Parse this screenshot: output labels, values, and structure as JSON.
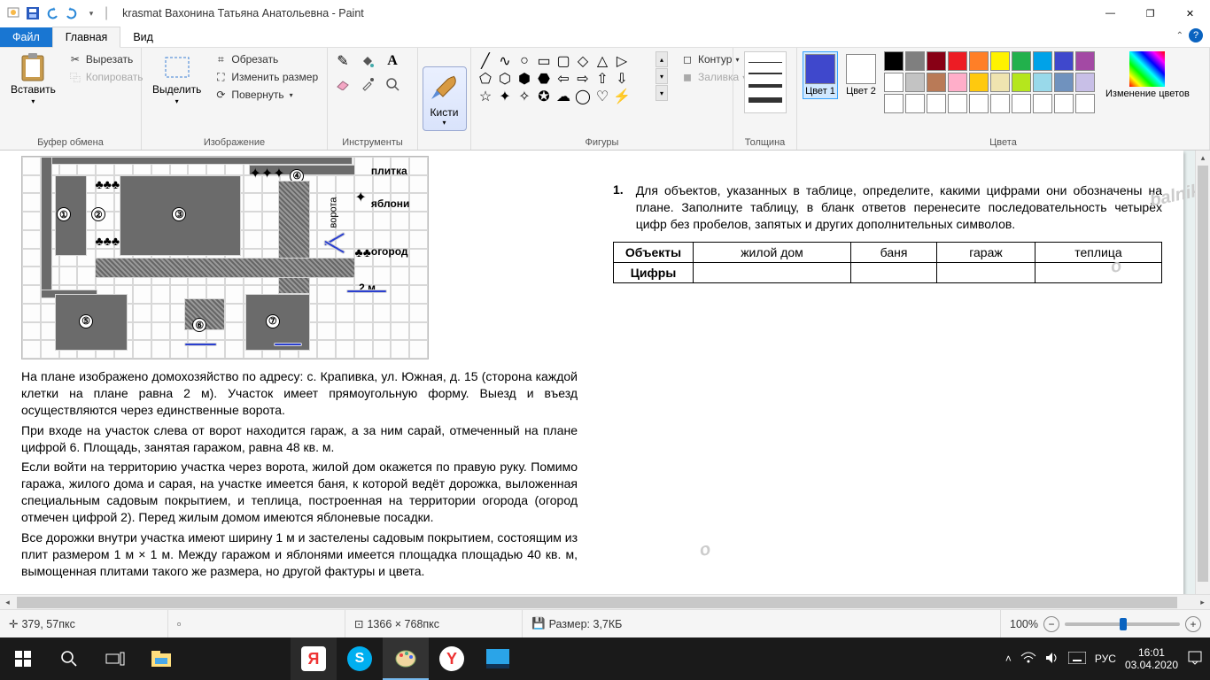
{
  "title": "krasmat Вахонина Татьяна Анатольевна - Paint",
  "tabs": {
    "file": "Файл",
    "home": "Главная",
    "view": "Вид"
  },
  "clipboard": {
    "paste": "Вставить",
    "cut": "Вырезать",
    "copy": "Копировать",
    "group": "Буфер обмена"
  },
  "image": {
    "select": "Выделить",
    "crop": "Обрезать",
    "resize": "Изменить размер",
    "rotate": "Повернуть",
    "group": "Изображение"
  },
  "tools": {
    "group": "Инструменты"
  },
  "brushes": {
    "label": "Кисти"
  },
  "shapes": {
    "outline": "Контур",
    "fill": "Заливка",
    "group": "Фигуры"
  },
  "size": {
    "label": "Толщина"
  },
  "color": {
    "c1": "Цвет 1",
    "c2": "Цвет 2",
    "group": "Цвета",
    "edit": "Изменение цветов"
  },
  "palette": [
    "#000000",
    "#7f7f7f",
    "#880015",
    "#ed1c24",
    "#ff7f27",
    "#fff200",
    "#22b14c",
    "#00a2e8",
    "#3f48cc",
    "#a349a4",
    "#ffffff",
    "#c3c3c3",
    "#b97a57",
    "#ffaec9",
    "#ffc90e",
    "#efe4b0",
    "#b5e61d",
    "#99d9ea",
    "#7092be",
    "#c8bfe7"
  ],
  "color1": "#3f48cc",
  "color2": "#ffffff",
  "status": {
    "pos": "379, 57пкс",
    "dim": "1366 × 768пкс",
    "size": "Размер: 3,7КБ",
    "zoom": "100%"
  },
  "taskbar": {
    "lang": "РУС",
    "time": "16:01",
    "date": "03.04.2020"
  },
  "doc": {
    "leg_tile": "плитка",
    "leg_apple": "яблони",
    "leg_garden": "огород",
    "leg_scale": "2 м",
    "p1": "На плане изображено домохозяйство по адресу: с. Крапивка, ул. Южная, д. 15 (сторона каждой клетки на плане равна 2 м). Участок имеет прямоугольную форму. Выезд и въезд осуществляются через единственные ворота.",
    "p2": "При входе на участок слева от ворот находится гараж, а за ним сарай, отмеченный на плане цифрой 6. Площадь, занятая гаражом, равна 48 кв. м.",
    "p3": "Если войти на территорию участка через ворота, жилой дом окажется по правую руку. Помимо гаража, жилого дома и сарая, на участке имеется баня, к которой ведёт дорожка, выложенная специальным садовым покрытием, и теплица, построенная на территории огорода (огород отмечен цифрой 2). Перед жилым домом имеются яблоневые посадки.",
    "p4": "Все дорожки внутри участка имеют ширину 1 м и застелены садовым покрытием, состоящим из плит размером 1 м × 1 м. Между гаражом и яблонями имеется площадка площадью 40 кв. м, вымощенная плитами такого же размера, но другой фактуры и цвета.",
    "qnum": "1.",
    "qtext": "Для объектов, указанных в таблице, определите, какими цифрами они обозначены на плане. Заполните таблицу, в бланк ответов перенесите последовательность четырёх цифр без пробелов, запятых и других дополнительных символов.",
    "th_obj": "Объекты",
    "th_num": "Цифры",
    "obj1": "жилой дом",
    "obj2": "баня",
    "obj3": "гараж",
    "obj4": "теплица"
  }
}
